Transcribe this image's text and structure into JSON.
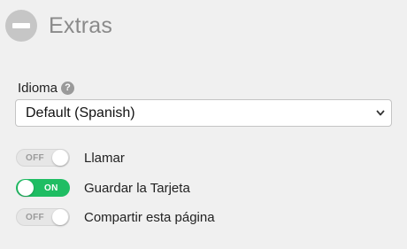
{
  "section": {
    "title": "Extras"
  },
  "language": {
    "label": "Idioma",
    "help_glyph": "?",
    "selected": "Default (Spanish)"
  },
  "toggles": [
    {
      "label": "Llamar",
      "state": "OFF",
      "on": false
    },
    {
      "label": "Guardar la Tarjeta",
      "state": "ON",
      "on": true
    },
    {
      "label": "Compartir esta página",
      "state": "OFF",
      "on": false
    }
  ],
  "colors": {
    "toggle_on": "#1fbd63",
    "toggle_off": "#e6e6e6",
    "header_icon": "#c6c6c6",
    "background": "#f0f0f0"
  }
}
